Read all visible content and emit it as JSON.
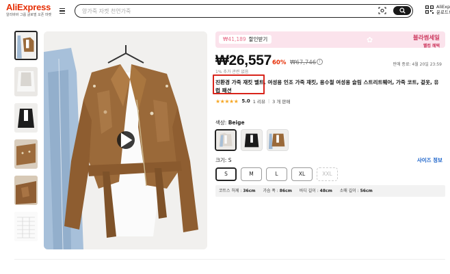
{
  "header": {
    "logo": "AliExpress",
    "logo_tagline": "알리바바 그룹 글로벌 오픈 마켓",
    "search_placeholder": "양가죽 자켓 천연가죽",
    "app_text_line1": "AliExp",
    "app_text_line2": "운로드!"
  },
  "promo": {
    "coupon_amount": "₩41,189",
    "coupon_label": "할인받기",
    "right_title": "블라썸세일",
    "right_sub": "웰컴 혜택"
  },
  "price": {
    "current": "₩26,557",
    "discount": "60%",
    "original": "₩67,746",
    "info_icon": "!",
    "sale_end": "판매 종료: 4월 20일 23:59",
    "tax_note": "1% 추가 관련 없음"
  },
  "product": {
    "title": "진환경 가죽 재킷 벨트, 여성용 인조 가죽 재킷, 용수철 여성용 슬림 스트리트웨어, 가죽 코트, 겉옷, 유럽 패션",
    "stars": "★★★★★",
    "rating": "5.0",
    "reviews": "1 리뷰",
    "separator": "|",
    "sold": "3 개 판매"
  },
  "color": {
    "label_prefix": "색상: ",
    "selected": "Beige"
  },
  "size": {
    "label": "크기: S",
    "guide": "사이즈 정보",
    "options": [
      "S",
      "M",
      "L",
      "XL",
      "XXL"
    ]
  },
  "measurements": [
    {
      "label": "코트스 허께 : ",
      "value": "36cm"
    },
    {
      "label": "가슴 폭 : ",
      "value": "86cm"
    },
    {
      "label": "바디 길이 : ",
      "value": "48cm"
    },
    {
      "label": "소매 길이 : ",
      "value": "56cm"
    }
  ],
  "colors": {
    "brand_red": "#e62e04",
    "promo_bg": "#fbe3ec",
    "link_blue": "#1760c9",
    "star": "#f5a623",
    "highlight_box": "#d8231a"
  }
}
